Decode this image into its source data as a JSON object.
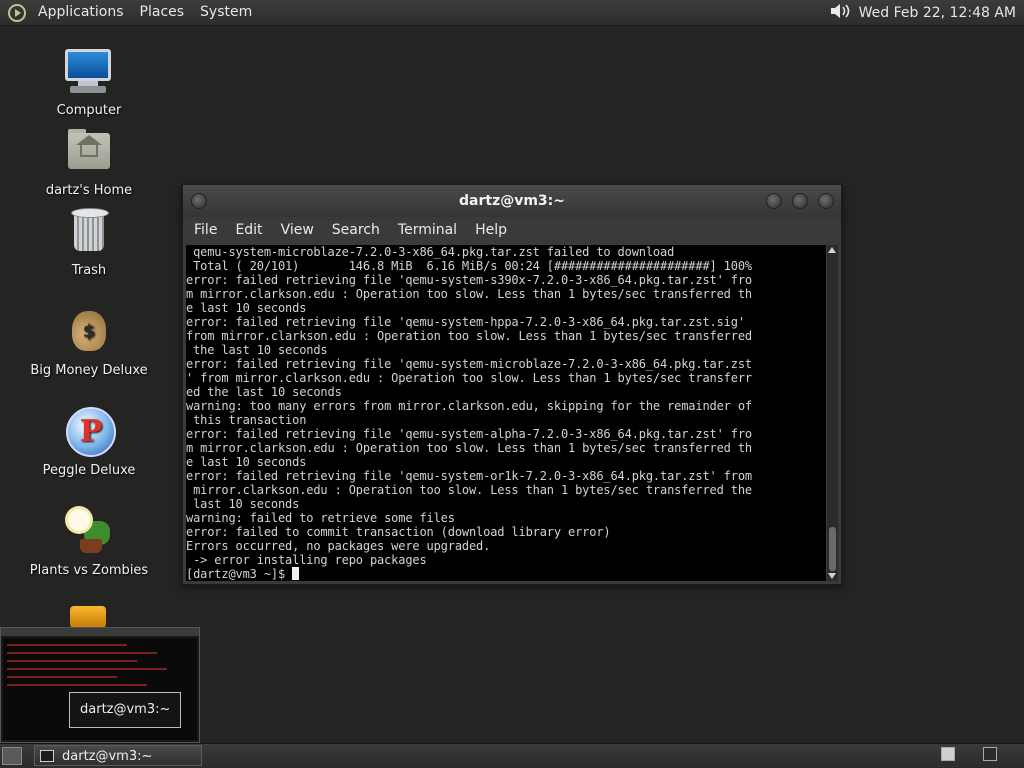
{
  "top_panel": {
    "menus": [
      "Applications",
      "Places",
      "System"
    ],
    "clock": "Wed Feb 22, 12:48 AM"
  },
  "desktop_icons": [
    {
      "label": "Computer",
      "icon": "computer-icon"
    },
    {
      "label": "dartz's Home",
      "icon": "home-folder-icon"
    },
    {
      "label": "Trash",
      "icon": "trash-icon"
    },
    {
      "label": "Big Money Deluxe",
      "icon": "money-bag-icon"
    },
    {
      "label": "Peggle Deluxe",
      "icon": "peggle-icon"
    },
    {
      "label": "Plants vs Zombies",
      "icon": "plants-vs-zombies-icon"
    }
  ],
  "terminal": {
    "title": "dartz@vm3:~",
    "menu": [
      "File",
      "Edit",
      "View",
      "Search",
      "Terminal",
      "Help"
    ],
    "lines": [
      " qemu-system-microblaze-7.2.0-3-x86_64.pkg.tar.zst failed to download",
      " Total ( 20/101)       146.8 MiB  6.16 MiB/s 00:24 [######################] 100%",
      "error: failed retrieving file 'qemu-system-s390x-7.2.0-3-x86_64.pkg.tar.zst' fro",
      "m mirror.clarkson.edu : Operation too slow. Less than 1 bytes/sec transferred th",
      "e last 10 seconds",
      "error: failed retrieving file 'qemu-system-hppa-7.2.0-3-x86_64.pkg.tar.zst.sig'",
      "from mirror.clarkson.edu : Operation too slow. Less than 1 bytes/sec transferred",
      " the last 10 seconds",
      "error: failed retrieving file 'qemu-system-microblaze-7.2.0-3-x86_64.pkg.tar.zst",
      "' from mirror.clarkson.edu : Operation too slow. Less than 1 bytes/sec transferr",
      "ed the last 10 seconds",
      "warning: too many errors from mirror.clarkson.edu, skipping for the remainder of",
      " this transaction",
      "error: failed retrieving file 'qemu-system-alpha-7.2.0-3-x86_64.pkg.tar.zst' fro",
      "m mirror.clarkson.edu : Operation too slow. Less than 1 bytes/sec transferred th",
      "e last 10 seconds",
      "error: failed retrieving file 'qemu-system-or1k-7.2.0-3-x86_64.pkg.tar.zst' from",
      " mirror.clarkson.edu : Operation too slow. Less than 1 bytes/sec transferred the",
      " last 10 seconds",
      "warning: failed to retrieve some files",
      "error: failed to commit transaction (download library error)",
      "Errors occurred, no packages were upgraded.",
      " -> error installing repo packages"
    ],
    "prompt": "[dartz@vm3 ~]$ "
  },
  "window_preview": {
    "tooltip": "dartz@vm3:~"
  },
  "taskbar": {
    "task_label": "dartz@vm3:~"
  },
  "colors": {
    "desktop_bg": "#242523",
    "panel_bg": "#353533",
    "terminal_bg": "#000000",
    "terminal_fg": "#d3d3d3"
  }
}
